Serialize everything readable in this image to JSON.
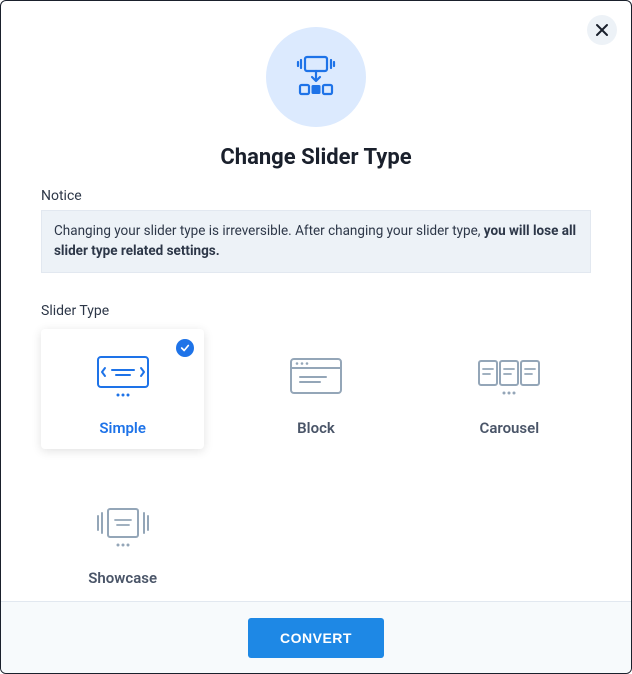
{
  "title": "Change Slider Type",
  "notice_label": "Notice",
  "notice_text_a": "Changing your slider type is irreversible. After changing your slider type, ",
  "notice_text_b": "you will lose all slider type related settings.",
  "slider_type_label": "Slider Type",
  "options": {
    "simple": "Simple",
    "block": "Block",
    "carousel": "Carousel",
    "showcase": "Showcase"
  },
  "selected_option": "simple",
  "convert_label": "CONVERT"
}
